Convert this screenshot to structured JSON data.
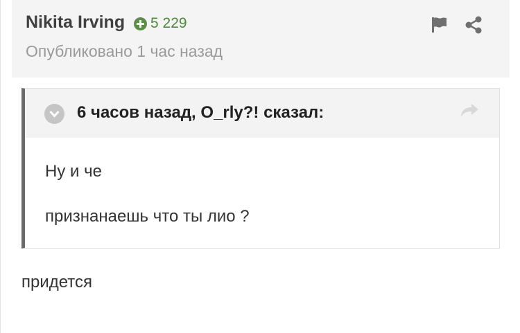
{
  "post": {
    "author": "Nikita Irving",
    "reputation": "5 229",
    "published": "Опубликовано 1 час назад",
    "icons": {
      "flag": "flag-icon",
      "share": "share-icon"
    }
  },
  "quote": {
    "citation": "6 часов назад, O_rly?! сказал:",
    "lines": [
      "Ну и че",
      "признанаешь что ты лио ?"
    ],
    "icons": {
      "toggle": "chevron-down-icon",
      "jump": "jump-to-quote-icon"
    }
  },
  "reply": "придется",
  "colors": {
    "reputation": "#4e8a3a",
    "header_bg": "#f4f4f4",
    "quote_border": "#6a6a6a"
  }
}
